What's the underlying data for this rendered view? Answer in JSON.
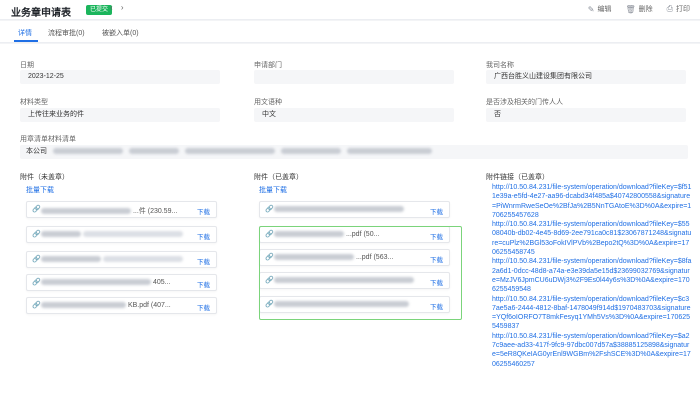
{
  "header": {
    "title": "业务章申请表",
    "status": "已提交",
    "nav": "‹ ›",
    "toolbar": [
      {
        "label": "编辑",
        "icon": "edit-icon",
        "glyph": "✎"
      },
      {
        "label": "删除",
        "icon": "delete-icon",
        "glyph": "🗑"
      },
      {
        "label": "打印",
        "icon": "print-icon",
        "glyph": "⎙"
      }
    ]
  },
  "tabs": [
    {
      "label": "详情",
      "active": true
    },
    {
      "label": "流程审批(0)",
      "active": false
    },
    {
      "label": "被嵌入单(0)",
      "active": false
    }
  ],
  "fields": {
    "date": {
      "label": "日期",
      "value": "2023-12-25"
    },
    "dept": {
      "label": "申请部门",
      "value": ""
    },
    "company": {
      "label": "我司名称",
      "value": "广西台胜义山建设集团有限公司"
    },
    "material_type": {
      "label": "材料类型",
      "value": "上传往来业务的件"
    },
    "language": {
      "label": "用文语种",
      "value": "中文"
    },
    "related": {
      "label": "是否涉及相关的门传人人",
      "value": "否"
    },
    "seal_list": {
      "label": "用章清单材料清单",
      "value": "本公司"
    }
  },
  "attachments_unsealed": {
    "title": "附件（未盖章）",
    "batch": "批量下载",
    "files": [
      {
        "name_suffix": "...件 (230.59...",
        "download": "下载"
      },
      {
        "name_suffix": "",
        "download": "下载"
      },
      {
        "name_suffix": "",
        "download": "下载"
      },
      {
        "name_suffix": "405...",
        "download": "下载"
      },
      {
        "name_suffix": "KB.pdf (407...",
        "download": "下载"
      }
    ]
  },
  "attachments_sealed": {
    "title": "附件（已盖章）",
    "batch": "批量下载",
    "files": [
      {
        "name_suffix": "",
        "download": "下载"
      },
      {
        "name_suffix": "...pdf (50...",
        "download": "下载"
      },
      {
        "name_suffix": "...pdf (563...",
        "download": "下载"
      },
      {
        "name_suffix": "",
        "download": "下载"
      },
      {
        "name_suffix": "",
        "download": "下载"
      }
    ]
  },
  "attachment_links": {
    "title": "附件链接（已盖章）",
    "links": [
      "http://10.50.84.231/file-system/operation/download?fileKey=$f511e39a-e5fd-4e27-aa96-dcabd34f485a$40742800558&signature=PiWnrmRweSeOe%2BfJa%2B5NnTGAtoE%3D%0A&expire=1706255457628",
      "http://10.50.84.231/file-system/operation/download?fileKey=$5508040b-db02-4e45-8d69-2ee791ca0c81$23067871248&signature=cuPlz%2BGl53oFokIVlPVb%2Bepo2tQ%3D%0A&expire=1706255458745",
      "http://10.50.84.231/file-system/operation/download?fileKey=$8fa2a6d1-0dcc-48d8-a74a-e3e39da5e15d$23699032769&signature=MzJV6JpmCU6uDWj3%2F9Es0l44y6s%3D%0A&expire=1706255459548",
      "http://10.50.84.231/file-system/operation/download?fileKey=$c37ae5a6-2444-4812-8baf-1478049f914d$1970483703&signature=YQf6oIORFO7T8mkFesyq1YMh5Vs%3D%0A&expire=1706255459837",
      "http://10.50.84.231/file-system/operation/download?fileKey=$a27c9aee-ad33-417f-9fc9-97dbc007d57a$38885125898&signature=5eR8QKeIAG0yrEnl9WGBm%2FshSCE%3D%0A&expire=1706255460257"
    ]
  },
  "colors": {
    "accent": "#1f6fe5",
    "status": "#1bb55c",
    "highlight": "#7bd47b"
  }
}
